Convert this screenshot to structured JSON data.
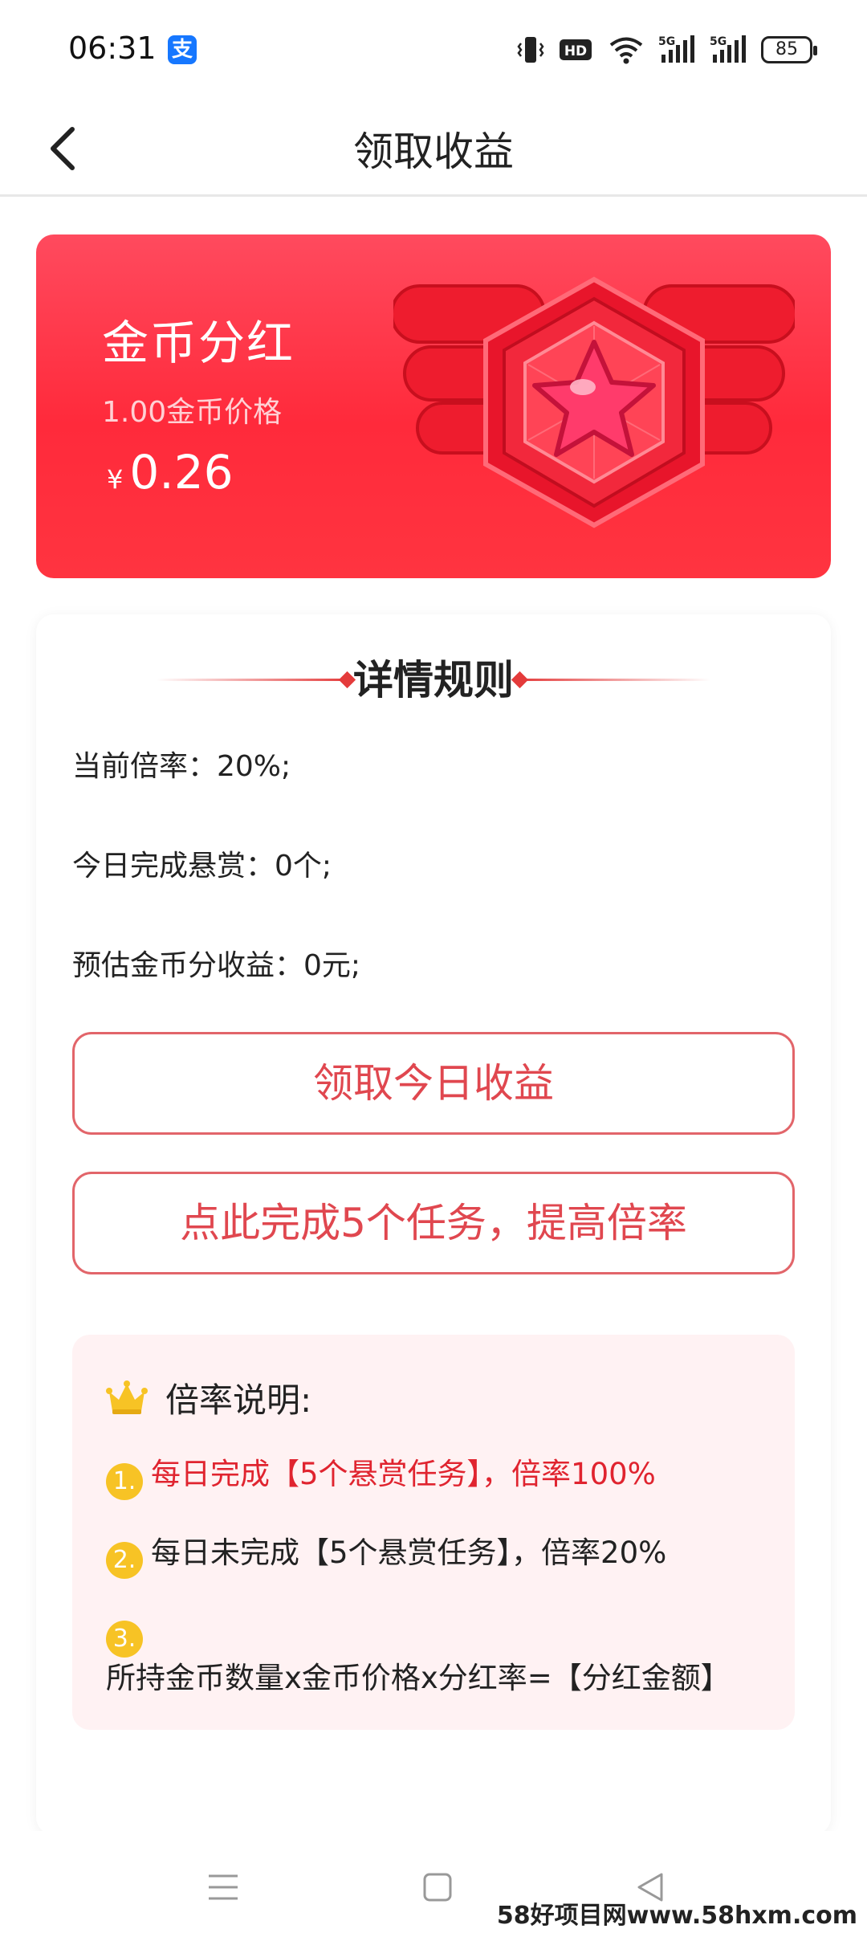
{
  "status_bar": {
    "time": "06:31",
    "alipay_glyph": "支",
    "hd_label": "HD",
    "net1": "5G",
    "net2": "5G",
    "battery": "85"
  },
  "header": {
    "title": "领取收益"
  },
  "banner": {
    "title": "金币分红",
    "subtitle": "1.00金币价格",
    "currency": "¥",
    "amount": "0.26"
  },
  "details": {
    "title": "详情规则",
    "lines": [
      "当前倍率：20%;",
      "今日完成悬赏：0个;",
      "预估金币分收益：0元;"
    ],
    "claim_button": "领取今日收益",
    "boost_button": "点此完成5个任务，提高倍率"
  },
  "explain": {
    "title": "倍率说明:",
    "items": [
      {
        "num": "1.",
        "text": "每日完成【5个悬赏任务】，倍率100%"
      },
      {
        "num": "2.",
        "text": "每日未完成【5个悬赏任务】，倍率20%"
      },
      {
        "num": "3.",
        "text": "所持金币数量x金币价格x分红率=【分红金额】"
      }
    ]
  },
  "watermark": "58好项目网www.58hxm.com",
  "colors": {
    "accent": "#e0474f",
    "highlight": "#e0242f",
    "badge_yellow": "#f7c325"
  }
}
